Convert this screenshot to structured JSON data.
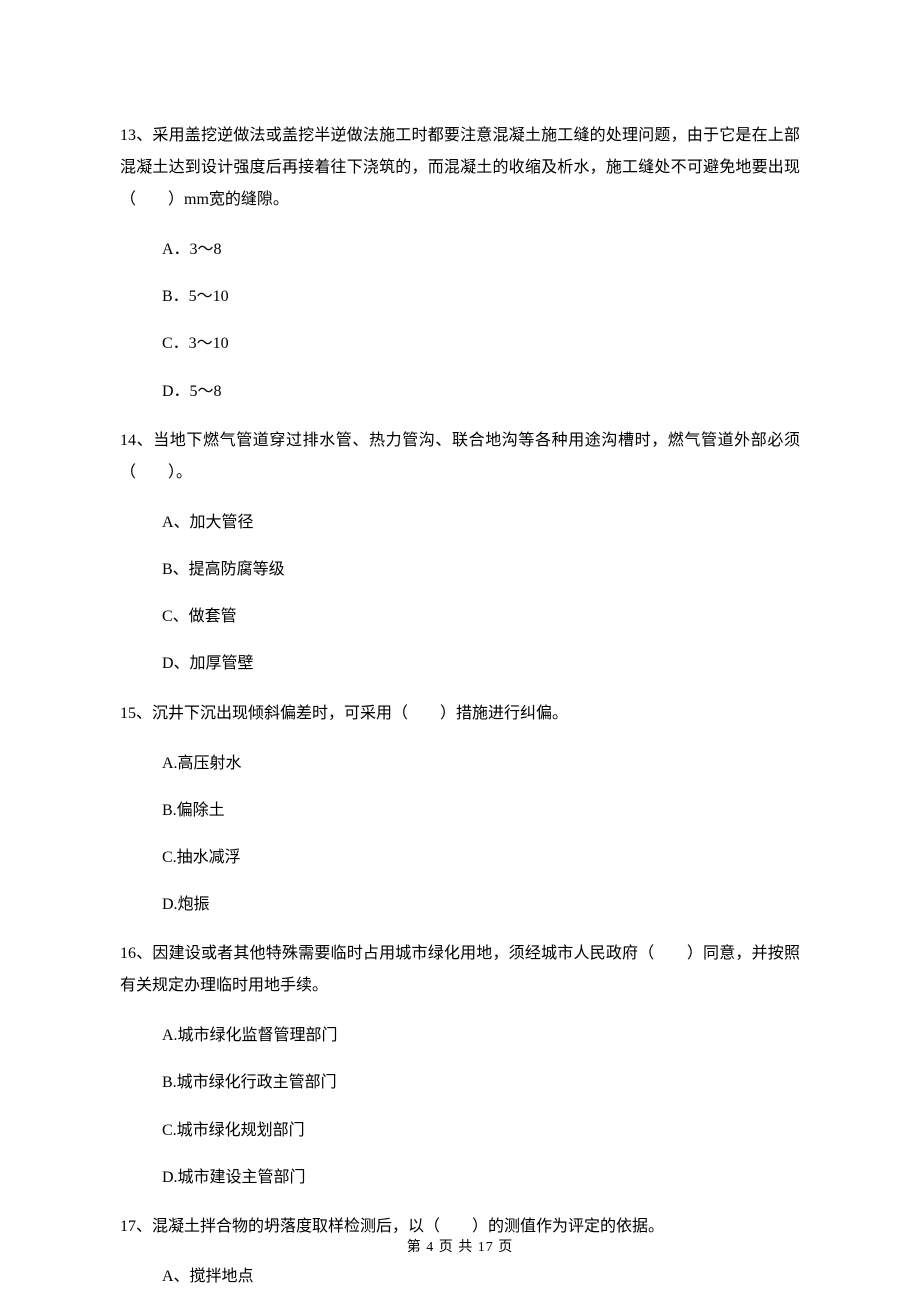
{
  "questions": [
    {
      "stem": "13、采用盖挖逆做法或盖挖半逆做法施工时都要注意混凝土施工缝的处理问题，由于它是在上部混凝土达到设计强度后再接着往下浇筑的，而混凝土的收缩及析水，施工缝处不可避免地要出现（　　）mm宽的缝隙。",
      "options": [
        "A．3～8",
        "B．5～10",
        "C．3～10",
        "D．5～8"
      ]
    },
    {
      "stem": "14、当地下燃气管道穿过排水管、热力管沟、联合地沟等各种用途沟槽时，燃气管道外部必须（　　）。",
      "options": [
        "A、加大管径",
        "B、提高防腐等级",
        "C、做套管",
        "D、加厚管壁"
      ]
    },
    {
      "stem": "15、沉井下沉出现倾斜偏差时，可采用（　　）措施进行纠偏。",
      "options": [
        "A.高压射水",
        "B.偏除土",
        "C.抽水减浮",
        "D.炮振"
      ]
    },
    {
      "stem": "16、因建设或者其他特殊需要临时占用城市绿化用地，须经城市人民政府（　　）同意，并按照有关规定办理临时用地手续。",
      "options": [
        "A.城市绿化监督管理部门",
        "B.城市绿化行政主管部门",
        "C.城市绿化规划部门",
        "D.城市建设主管部门"
      ]
    },
    {
      "stem": "17、混凝土拌合物的坍落度取样检测后，以（　　）的测值作为评定的依据。",
      "options": [
        "A、搅拌地点"
      ]
    }
  ],
  "footer": "第 4 页 共 17 页"
}
